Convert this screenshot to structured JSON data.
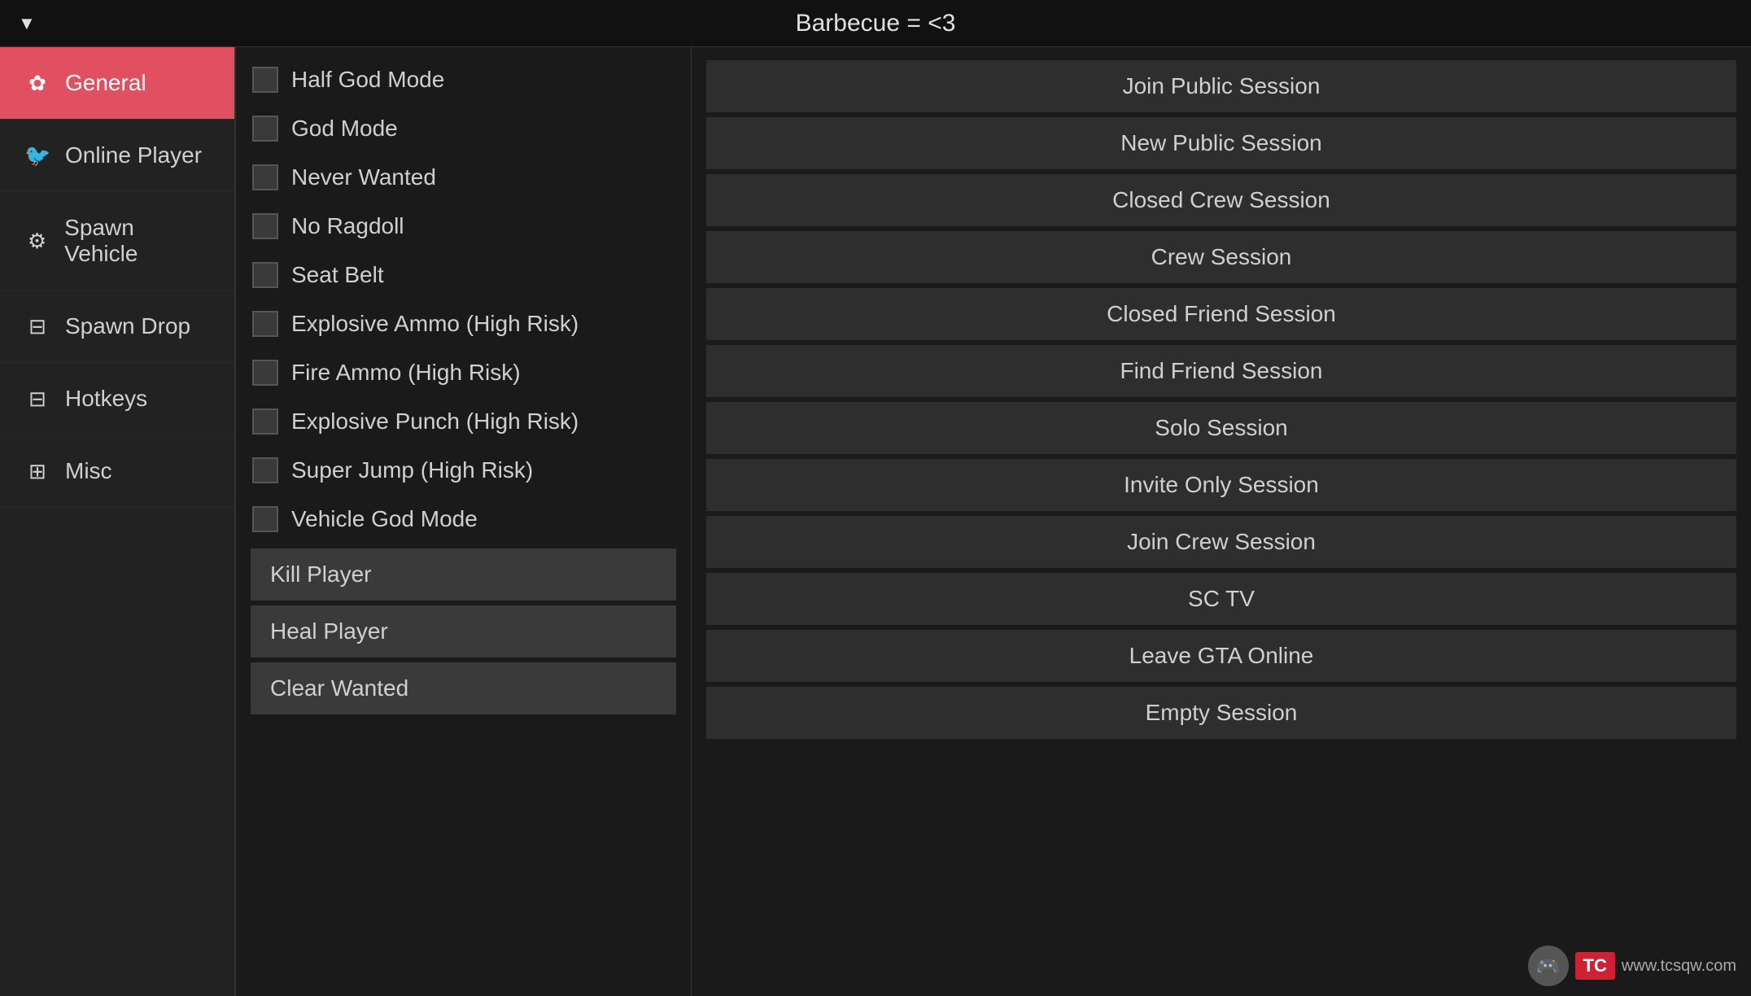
{
  "titlebar": {
    "title": "Barbecue = <3",
    "dropdown_symbol": "▼"
  },
  "sidebar": {
    "items": [
      {
        "id": "general",
        "label": "General",
        "icon": "⚙",
        "icon_type": "gear",
        "active": true
      },
      {
        "id": "online-player",
        "label": "Online Player",
        "icon": "🐦",
        "icon_type": "bird",
        "active": false
      },
      {
        "id": "spawn-vehicle",
        "label": "Spawn Vehicle",
        "icon": "⚙",
        "icon_type": "gear",
        "active": false
      },
      {
        "id": "spawn-drop",
        "label": "Spawn Drop",
        "icon": "⊞",
        "icon_type": "package",
        "active": false
      },
      {
        "id": "hotkeys",
        "label": "Hotkeys",
        "icon": "⊟",
        "icon_type": "keyboard",
        "active": false
      },
      {
        "id": "misc",
        "label": "Misc",
        "icon": "⊞",
        "icon_type": "building",
        "active": false
      }
    ]
  },
  "left_panel": {
    "toggles": [
      {
        "id": "half-god-mode",
        "label": "Half God Mode",
        "checked": false
      },
      {
        "id": "god-mode",
        "label": "God Mode",
        "checked": false
      },
      {
        "id": "never-wanted",
        "label": "Never Wanted",
        "checked": false
      },
      {
        "id": "no-ragdoll",
        "label": "No Ragdoll",
        "checked": false
      },
      {
        "id": "seat-belt",
        "label": "Seat Belt",
        "checked": false
      },
      {
        "id": "explosive-ammo",
        "label": "Explosive Ammo (High Risk)",
        "checked": false
      },
      {
        "id": "fire-ammo",
        "label": "Fire Ammo (High Risk)",
        "checked": false
      },
      {
        "id": "explosive-punch",
        "label": "Explosive Punch (High Risk)",
        "checked": false
      },
      {
        "id": "super-jump",
        "label": "Super Jump (High Risk)",
        "checked": false
      },
      {
        "id": "vehicle-god-mode",
        "label": "Vehicle God Mode",
        "checked": false
      }
    ],
    "buttons": [
      {
        "id": "kill-player",
        "label": "Kill Player"
      },
      {
        "id": "heal-player",
        "label": "Heal Player"
      },
      {
        "id": "clear-wanted",
        "label": "Clear Wanted"
      }
    ]
  },
  "right_panel": {
    "session_buttons": [
      {
        "id": "join-public-session",
        "label": "Join Public Session"
      },
      {
        "id": "new-public-session",
        "label": "New Public Session"
      },
      {
        "id": "closed-crew-session",
        "label": "Closed Crew Session"
      },
      {
        "id": "crew-session",
        "label": "Crew Session"
      },
      {
        "id": "closed-friend-session",
        "label": "Closed Friend Session"
      },
      {
        "id": "find-friend-session",
        "label": "Find Friend Session"
      },
      {
        "id": "solo-session",
        "label": "Solo Session"
      },
      {
        "id": "invite-only-session",
        "label": "Invite Only Session"
      },
      {
        "id": "join-crew-session",
        "label": "Join Crew Session"
      },
      {
        "id": "sc-tv",
        "label": "SC TV"
      },
      {
        "id": "leave-gta-online",
        "label": "Leave GTA Online"
      },
      {
        "id": "empty-session",
        "label": "Empty Session"
      }
    ]
  },
  "watermark": {
    "badge": "TC",
    "url": "www.tcsqw.com",
    "icon": "🎮"
  }
}
